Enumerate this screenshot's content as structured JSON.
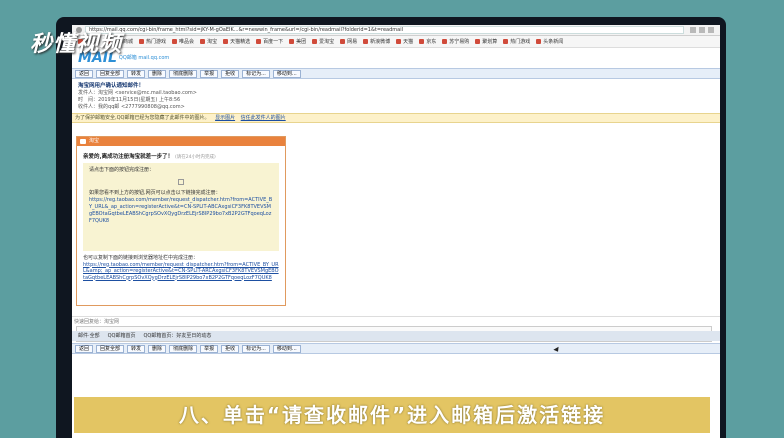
{
  "watermark": "秒懂视频",
  "browser": {
    "url": "https://mail.qq.com/cgi-bin/frame_html?sid=jKY-M-gOaEIK...&r=newwin_frame&url=/cgi-bin/readmail?folderid=1&t=readmail",
    "bookmarks": [
      "腾讯网",
      "京东商城",
      "热门游戏",
      "唯品会",
      "淘宝",
      "天猫精选",
      "百度一下",
      "美团",
      "爱淘宝",
      "网易",
      "新浪微博",
      "天猫",
      "京东",
      "苏宁易购",
      "聚划算",
      "热门游戏",
      "头条新闻"
    ]
  },
  "logo": {
    "mark": "MAIL",
    "sub": "QQ邮箱\nmail.qq.com"
  },
  "toolbar": [
    "返回",
    "回复全部",
    "转发",
    "删除",
    "彻底删除",
    "举报",
    "拒收",
    "标记为...",
    "移动到..."
  ],
  "header": {
    "subject": "淘宝网用户确认通知邮件！",
    "from_label": "发件人：",
    "from": "淘宝网 <service@mc.mail.taobao.com>",
    "time_label": "时　间：",
    "time": "2019年11月15日(星期五) 上午8:56",
    "to_label": "收件人：",
    "to": "我的qq邮 <2777990808@qq.com>"
  },
  "notice": {
    "text": "为了保护邮箱安全,QQ邮箱已经为您隐藏了此邮件中的图片。",
    "link1": "显示图片",
    "link2": "信任此发件人的图片"
  },
  "mail": {
    "brand": "淘宝",
    "title": "亲爱的,离成功注册淘宝就差一步了！",
    "title_sub": "(请在24小时内完成)",
    "p1": "请点击下面的按钮完成注册：",
    "p2": "如果您看不到上方的按钮,网页可以点击以下链接完成注册：",
    "link": "https://reg.taobao.com/member/request_dispatcher.htm?from=ACTIVE_BY_URL&_ap_action=registerActive&t=CN-SPLIT-ABCAxgsiCF3FK8TVEVSMgEBOtaGqtbeLEABShCgrpSOvXQygDrzELEjrS8IP29bo7xB2P2GTFqoeqLozF7QUK8",
    "p3": "也可以复制下面的链接到浏览器地址栏中完成注册：",
    "link2": "https://reg.taobao.com/member/request_dispatcher.htm?from=ACTIVE_BY_URL&amp;_ap_action=registerActive&t=CN-SPLIT-ARCAxgsiCF3FK8TVEVSMgEBOtaGqtbeLEABShCgrpSOvXQygDrzELEjrS8IP29bo7xB2P2GTFqoeqLozF7QUK8"
  },
  "reply": "快速回复给：淘宝网",
  "tabs": [
    "邮件·全部",
    "QQ邮箱首页",
    "QQ邮箱首页：好友至日的动态"
  ],
  "caption": "八、单击“请查收邮件”进入邮箱后激活链接"
}
